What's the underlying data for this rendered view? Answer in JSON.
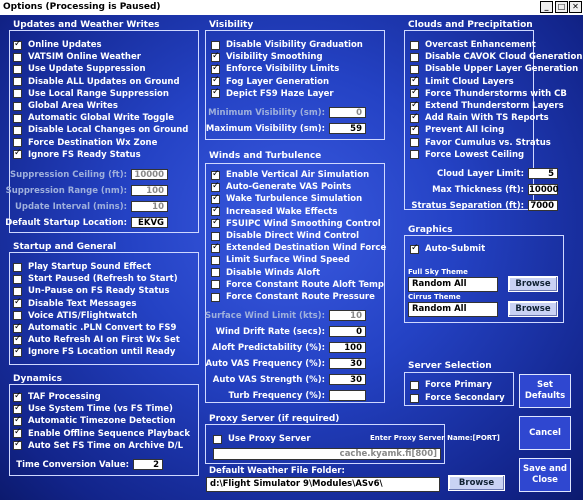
{
  "title": "Options (Processing is Paused)",
  "updates": {
    "title": "Updates and Weather Writes",
    "checks": [
      {
        "label": "Online Updates",
        "checked": true
      },
      {
        "label": "VATSIM Online Weather",
        "checked": false
      },
      {
        "label": "Use Update Suppression",
        "checked": false
      },
      {
        "label": "Disable ALL Updates on Ground",
        "checked": false
      },
      {
        "label": "Use Local Range Suppression",
        "checked": false
      },
      {
        "label": "Global Area Writes",
        "checked": false
      },
      {
        "label": "Automatic Global Write Toggle",
        "checked": false
      },
      {
        "label": "Disable Local Changes on Ground",
        "checked": false
      },
      {
        "label": "Force Destination Wx Zone",
        "checked": false
      },
      {
        "label": "Ignore FS Ready Status",
        "checked": true
      }
    ],
    "fields": [
      {
        "label": "Suppression Ceiling (ft):",
        "value": "10000",
        "dim": true
      },
      {
        "label": "Suppression Range (nm):",
        "value": "100",
        "dim": true
      },
      {
        "label": "Update Interval (mins):",
        "value": "10",
        "dim": true
      },
      {
        "label": "Default Startup Location:",
        "value": "EKVG",
        "dim": false
      }
    ]
  },
  "startup": {
    "title": "Startup and General",
    "checks": [
      {
        "label": "Play Startup Sound Effect",
        "checked": false
      },
      {
        "label": "Start Paused (Refresh to Start)",
        "checked": false
      },
      {
        "label": "Un-Pause on FS Ready Status",
        "checked": false
      },
      {
        "label": "Disable Text Messages",
        "checked": true
      },
      {
        "label": "Voice ATIS/Flightwatch",
        "checked": false
      },
      {
        "label": "Automatic .PLN Convert to FS9",
        "checked": true
      },
      {
        "label": "Auto Refresh AI on First Wx Set",
        "checked": true
      },
      {
        "label": "Ignore FS Location until Ready",
        "checked": true
      }
    ]
  },
  "dynamics": {
    "title": "Dynamics",
    "checks": [
      {
        "label": "TAF Processing",
        "checked": true
      },
      {
        "label": "Use System Time (vs FS Time)",
        "checked": true
      },
      {
        "label": "Automatic Timezone Detection",
        "checked": true
      },
      {
        "label": "Enable Offline Sequence Playback",
        "checked": true
      },
      {
        "label": "Auto Set FS Time on Archive D/L",
        "checked": true
      }
    ],
    "field": {
      "label": "Time Conversion Value:",
      "value": "2"
    }
  },
  "visibility": {
    "title": "Visibility",
    "checks": [
      {
        "label": "Disable Visibility Graduation",
        "checked": false
      },
      {
        "label": "Visibility Smoothing",
        "checked": true
      },
      {
        "label": "Enforce Visibility Limits",
        "checked": true
      },
      {
        "label": "Fog Layer Generation",
        "checked": true
      },
      {
        "label": "Depict FS9 Haze Layer",
        "checked": true
      }
    ],
    "fields": [
      {
        "label": "Minimum Visibility (sm):",
        "value": "0",
        "dim": true
      },
      {
        "label": "Maximum Visibility (sm):",
        "value": "59",
        "dim": false
      }
    ]
  },
  "winds": {
    "title": "Winds and Turbulence",
    "checks": [
      {
        "label": "Enable Vertical Air Simulation",
        "checked": true
      },
      {
        "label": "Auto-Generate VAS Points",
        "checked": true
      },
      {
        "label": "Wake Turbulence Simulation",
        "checked": true
      },
      {
        "label": "Increased Wake Effects",
        "checked": true
      },
      {
        "label": "FSUIPC Wind Smoothing Control",
        "checked": true
      },
      {
        "label": "Disable Direct Wind Control",
        "checked": false
      },
      {
        "label": "Extended Destination Wind Force",
        "checked": true
      },
      {
        "label": "Limit Surface Wind Speed",
        "checked": false
      },
      {
        "label": "Disable Winds Aloft",
        "checked": false
      },
      {
        "label": "Force Constant Route Aloft Temp",
        "checked": false
      },
      {
        "label": "Force Constant Route Pressure",
        "checked": false
      }
    ],
    "fields": [
      {
        "label": "Surface Wind Limit (kts):",
        "value": "10",
        "dim": true
      },
      {
        "label": "Wind Drift Rate (secs):",
        "value": "0",
        "dim": false
      },
      {
        "label": "Aloft Predictability (%):",
        "value": "100",
        "dim": false
      },
      {
        "label": "Auto VAS Frequency (%):",
        "value": "30",
        "dim": false
      },
      {
        "label": "Auto VAS Strength (%):",
        "value": "30",
        "dim": false
      },
      {
        "label": "Turb Frequency (%):",
        "value": "",
        "dim": false
      }
    ]
  },
  "proxy": {
    "title": "Proxy Server (if required)",
    "check": {
      "label": "Use Proxy Server",
      "checked": false
    },
    "hint": "Enter Proxy Server Name:[PORT]",
    "value": "cache.kyamk.fi[800]",
    "folder_label": "Default Weather File Folder:",
    "folder_value": "d:\\Flight Simulator 9\\Modules\\ASv6\\",
    "browse": "Browse"
  },
  "clouds": {
    "title": "Clouds and Precipitation",
    "checks": [
      {
        "label": "Overcast Enhancement",
        "checked": false
      },
      {
        "label": "Disable CAVOK Cloud Generation",
        "checked": false
      },
      {
        "label": "Disable Upper Layer Generation",
        "checked": false
      },
      {
        "label": "Limit Cloud Layers",
        "checked": true
      },
      {
        "label": "Force Thunderstorms with CB",
        "checked": true
      },
      {
        "label": "Extend Thunderstorm Layers",
        "checked": true
      },
      {
        "label": "Add Rain With TS Reports",
        "checked": true
      },
      {
        "label": "Prevent All Icing",
        "checked": true
      },
      {
        "label": "Favor Cumulus vs. Stratus",
        "checked": false
      },
      {
        "label": "Force Lowest Ceiling",
        "checked": false
      }
    ],
    "fields": [
      {
        "label": "Cloud Layer Limit:",
        "value": "5"
      },
      {
        "label": "Max Thickness (ft):",
        "value": "10000"
      },
      {
        "label": "Stratus Separation (ft):",
        "value": "7000"
      }
    ]
  },
  "graphics": {
    "title": "Graphics",
    "check": {
      "label": "Auto-Submit",
      "checked": true
    },
    "full_sky_label": "Full Sky Theme",
    "full_sky_value": "Random All",
    "cirrus_label": "Cirrus Theme",
    "cirrus_value": "Random All",
    "browse": "Browse"
  },
  "server": {
    "title": "Server Selection",
    "checks": [
      {
        "label": "Force Primary",
        "checked": false
      },
      {
        "label": "Force Secondary",
        "checked": false
      }
    ]
  },
  "buttons": {
    "set_defaults": "Set Defaults",
    "cancel": "Cancel",
    "save_close": "Save and Close"
  }
}
